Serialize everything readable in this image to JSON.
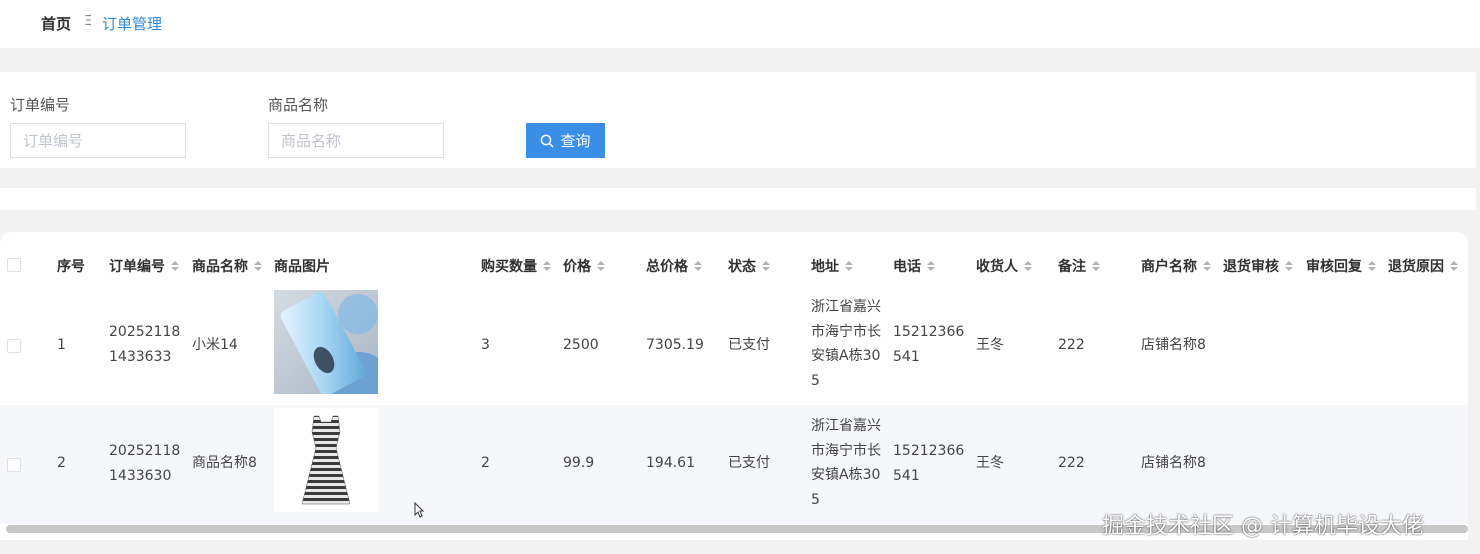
{
  "breadcrumb": {
    "home": "首页",
    "separator": "Ξ",
    "current": "订单管理"
  },
  "search": {
    "order_no_label": "订单编号",
    "order_no_placeholder": "订单编号",
    "product_label": "商品名称",
    "product_placeholder": "商品名称",
    "query_button": "查询",
    "query_icon": "search-icon"
  },
  "table": {
    "columns": [
      "序号",
      "订单编号",
      "商品名称",
      "商品图片",
      "购买数量",
      "价格",
      "总价格",
      "状态",
      "地址",
      "电话",
      "收货人",
      "备注",
      "商户名称",
      "退货审核",
      "审核回复",
      "退货原因"
    ],
    "rows": [
      {
        "index": "1",
        "order_no": "202521181433633",
        "product_name": "小米14",
        "image": "smartphone-photo",
        "quantity": "3",
        "price": "2500",
        "total": "7305.19",
        "status": "已支付",
        "address": "浙江省嘉兴市海宁市长安镇A栋305",
        "phone": "15212366541",
        "receiver": "王冬",
        "remark": "222",
        "merchant": "店铺名称8",
        "return_review": "",
        "review_reply": "",
        "return_reason": ""
      },
      {
        "index": "2",
        "order_no": "202521181433630",
        "product_name": "商品名称8",
        "image": "striped-dress-photo",
        "quantity": "2",
        "price": "99.9",
        "total": "194.61",
        "status": "已支付",
        "address": "浙江省嘉兴市海宁市长安镇A栋305",
        "phone": "15212366541",
        "receiver": "王冬",
        "remark": "222",
        "merchant": "店铺名称8",
        "return_review": "",
        "review_reply": "",
        "return_reason": ""
      }
    ]
  },
  "watermark": "掘金技术社区 @ 计算机毕设大佬",
  "colors": {
    "accent": "#3a8ee6",
    "breadcrumb_link": "#2f8bd6",
    "row_alt": "#f5f7fa",
    "page_bg": "#f2f2f2"
  }
}
